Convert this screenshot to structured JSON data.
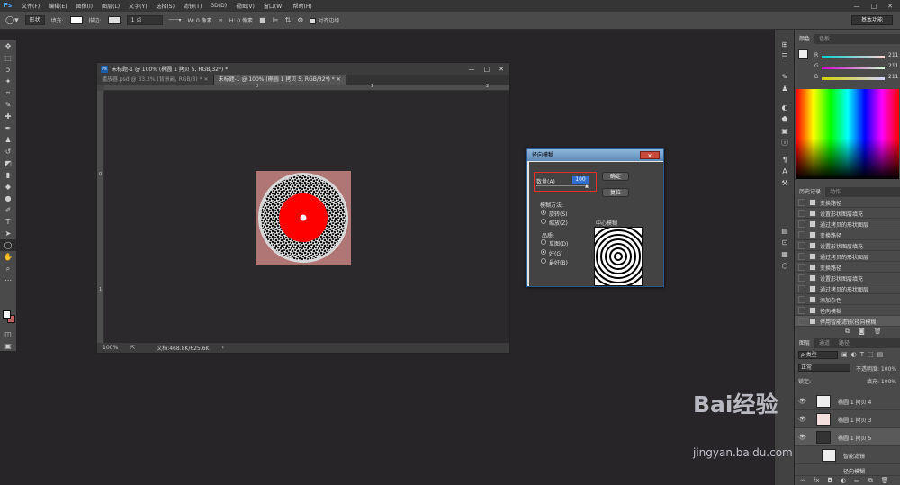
{
  "menubar": {
    "logo": "Ps",
    "items": [
      "文件(F)",
      "编辑(E)",
      "图像(I)",
      "图层(L)",
      "文字(Y)",
      "选择(S)",
      "滤镜(T)",
      "3D(D)",
      "视图(V)",
      "窗口(W)",
      "帮助(H)"
    ],
    "window_controls": [
      "—",
      "□",
      "✕"
    ]
  },
  "optbar": {
    "mode": "形状",
    "fill_label": "填充:",
    "stroke_label": "描边:",
    "stroke_width": "1 点",
    "w_label": "W: 0 像素",
    "h_label": "H: 0 像素",
    "align_edges": "对齐边缘",
    "workspace": "基本功能"
  },
  "document": {
    "title": "未标题-1 @ 100% (椭圆 1 拷贝 5, RGB/32*) *",
    "tabs": [
      {
        "label": "播放器.psd @ 33.3% (背景副, RGB/8) *"
      },
      {
        "label": "未标题-1 @ 100% (椭圆 1 拷贝 5, RGB/32*) *"
      }
    ],
    "ruler_top": [
      "0",
      "1",
      "2"
    ],
    "ruler_left": [
      "0",
      "1"
    ],
    "zoom": "100%",
    "doc_size": "文档:468.8K/625.6K"
  },
  "dialog": {
    "title": "径向模糊",
    "close": "✕",
    "amount_label": "数量(A)",
    "amount_value": "100",
    "ok": "确定",
    "reset": "复位",
    "method_label": "模糊方法:",
    "method_spin": "旋转(S)",
    "method_zoom": "缩放(Z)",
    "quality_label": "品质:",
    "quality_draft": "草图(D)",
    "quality_good": "好(G)",
    "quality_best": "最好(B)",
    "center_label": "中心模糊"
  },
  "color_panel": {
    "tabs": [
      "颜色",
      "色板"
    ],
    "r_label": "R",
    "g_label": "G",
    "b_label": "B",
    "r": "211",
    "g": "211",
    "b": "211"
  },
  "history": {
    "tabs": [
      "历史记录",
      "动作"
    ],
    "items": [
      "变换路径",
      "设置形状图层填充",
      "通过拷贝的形状图层",
      "变换路径",
      "设置形状图层填充",
      "通过拷贝的形状图层",
      "变换路径",
      "设置形状图层填充",
      "通过拷贝的形状图层",
      "添加杂色",
      "径向模糊",
      "停用智能滤镜(径向模糊)"
    ]
  },
  "layers": {
    "tabs": [
      "图层",
      "通道",
      "路径"
    ],
    "kind_label": "ρ 类型",
    "blend": "正常",
    "opacity": "不透明度: 100%",
    "lock": "锁定:",
    "fill": "填充: 100%",
    "items": [
      {
        "name": "椭圆 1 拷贝 4"
      },
      {
        "name": "椭圆 1 拷贝 3"
      },
      {
        "name": "椭圆 1 拷贝 5"
      },
      {
        "name": "智能滤镜"
      },
      {
        "name": "径向模糊"
      }
    ]
  },
  "watermark": {
    "brand": "Bai经验",
    "url": "jingyan.baidu.com"
  }
}
